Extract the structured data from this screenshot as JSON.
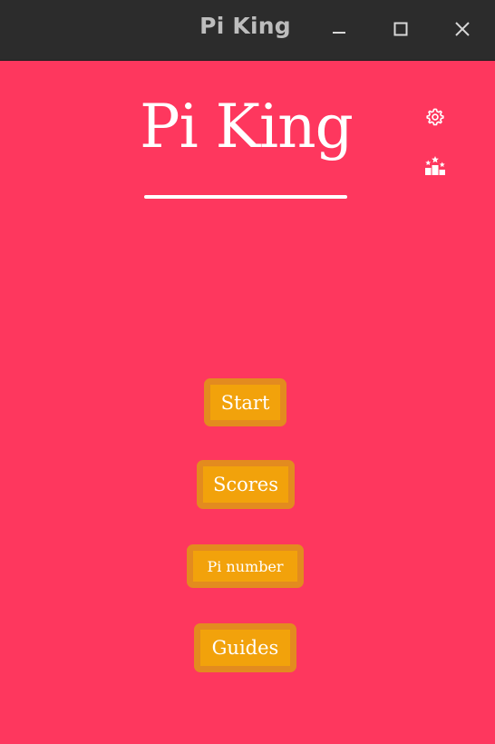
{
  "window": {
    "title": "Pi King",
    "controls": [
      "minimize-icon",
      "maximize-icon",
      "close-icon"
    ]
  },
  "app": {
    "title": "Pi King",
    "side_icons": [
      "settings-icon",
      "ranking-icon"
    ]
  },
  "menu": {
    "start_label": "Start",
    "scores_label": "Scores",
    "pi_number_label": "Pi number",
    "guides_label": "Guides"
  },
  "colors": {
    "background": "#fe375e",
    "button_fill": "#f2a20b",
    "button_border": "#e38b1f",
    "titlebar": "#2c2c2c",
    "text": "#ffffff"
  }
}
